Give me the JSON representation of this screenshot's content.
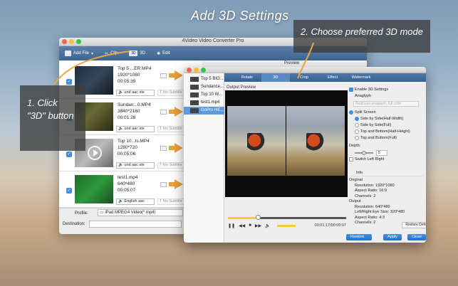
{
  "headline": "Add 3D Settings",
  "callouts": {
    "step1": "1. Click \"3D\" button",
    "step2": "2. Choose preferred 3D mode"
  },
  "main_window": {
    "title": "4Video Video Converter Pro",
    "toolbar": {
      "add_file": "Add File",
      "clip": "Clip",
      "d3": "3D",
      "edit": "Edit"
    },
    "preview_label": "Preview",
    "files": [
      {
        "name": "Top 5 ...ER.MP4",
        "resolution": "1920*1080",
        "duration": "00:05:39",
        "audio": "und aac ste",
        "subtitle": "No Subtitle"
      },
      {
        "name": "Sundan...0.MP4",
        "resolution": "3840*2160",
        "duration": "00:01:28",
        "audio": "und aac ste",
        "subtitle": "No Subtitle"
      },
      {
        "name": "Top 10...ls.MP4",
        "resolution": "1280*720",
        "duration": "00:05:06",
        "audio": "und aac ste",
        "subtitle": "No Subtitle"
      },
      {
        "name": "test1.mp4",
        "resolution": "640*480",
        "duration": "00:05:07",
        "audio": "English aac",
        "subtitle": "No Subtitle"
      }
    ],
    "profile_label": "Profile:",
    "profile_value": "iPad MPEG4 Video(*.mp4)",
    "destination_label": "Destination:"
  },
  "dialog": {
    "files": [
      "Top 5 BIG...",
      "Sundance...",
      "Top 10 W...",
      "test1.mp4",
      "GoPro HE..."
    ],
    "tabs": [
      "Rotate",
      "3D",
      "Crop",
      "Effect",
      "Watermark"
    ],
    "active_tab": "3D",
    "output_preview": "Output Preview",
    "timecode": "00:01:17/00:05:07",
    "playback_progress": 0.25,
    "enable_3d": "Enable 3D Settings",
    "anaglyph": "Anaglyph",
    "anaglyph_option": "Red/cyan anaglyph, full color",
    "split_screen": "Split Screen",
    "split_options": [
      "Side by Side(Half-Width)",
      "Side by Side(Full)",
      "Top and Bottom(Half-Height)",
      "Top and Bottom(Full)"
    ],
    "depth_label": "Depth:",
    "depth_value": "5",
    "switch_lr": "Switch Left Right",
    "info_title": "Info",
    "original_label": "Original",
    "original": [
      "Resolution: 1920*1080",
      "Aspect Ratio: 16:9",
      "Channels: 2"
    ],
    "output_label": "Output",
    "output": [
      "Resolution: 640*480",
      "Left/Right Eye Size: 320*480",
      "Aspect Ratio: 4:3",
      "Channels: 2"
    ],
    "restore_defaults": "Restore Defaults",
    "buttons": {
      "restore_all": "Restore All",
      "apply": "Apply",
      "close": "Close"
    }
  },
  "colors": {
    "accent": "#3d8ee0",
    "toolbar": "#3e6491",
    "arrow": "#e8a23a",
    "highlight": "#ffc82e"
  }
}
